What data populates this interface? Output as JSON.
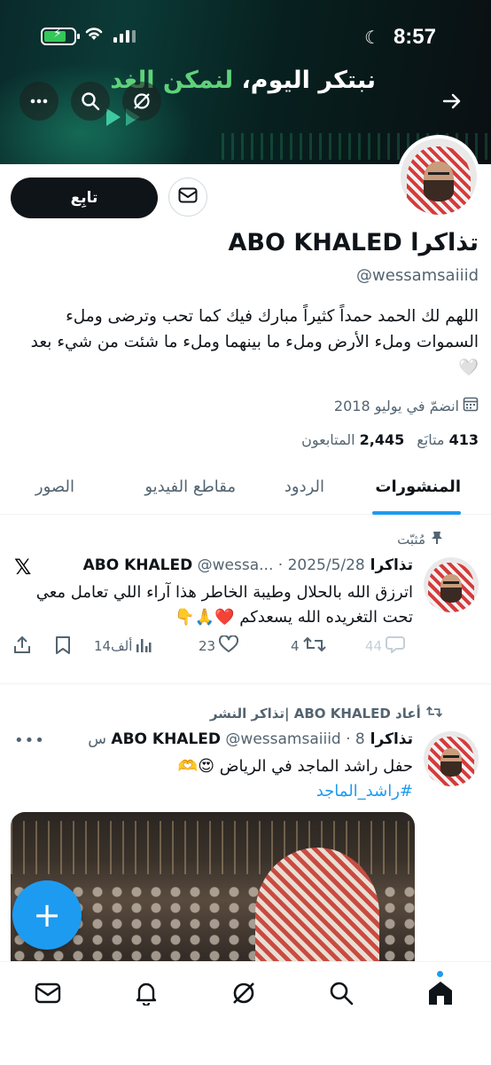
{
  "status_bar": {
    "time": "8:57"
  },
  "banner": {
    "text_white": "نبتكر اليوم، ",
    "text_green": "لنمكن الغد"
  },
  "profile": {
    "follow_label": "تابِع",
    "display_name": "تذاكرا ABO KHALED",
    "handle": "@wessamsaiiid",
    "bio": "اللهم لك الحمد حمداً كثيراً مبارك فيك كما تحب وترضى وملء السموات وملء الأرض وملء ما بينهما وملء ما شئت من شيء بعد",
    "bio_emoji": "🤍",
    "joined": "انضمّ في يوليو 2018",
    "following_count": "413",
    "following_label": "متابَع",
    "followers_count": "2,445",
    "followers_label": "المتابعون"
  },
  "tabs": [
    {
      "label": "المنشورات"
    },
    {
      "label": "الردود"
    },
    {
      "label": "مقاطع الفيديو"
    },
    {
      "label": "الصور"
    }
  ],
  "tweets": [
    {
      "context": "مُثبّت",
      "name": "تذاكرا ABO KHALED",
      "meta": "@wessa... · 2025/5/28",
      "text": "اترزق الله بالحلال وطيبة الخاطر هذا آراء اللي تعامل معي تحت التغريده الله يسعدكم ❤️🙏👇",
      "replies": "44",
      "retweets": "4",
      "likes": "23",
      "views": "14ألف"
    },
    {
      "context": "أعاد ABO KHALED |تذاكر النشر",
      "name": "تذاكرا ABO KHALED",
      "meta": "@wessamsaiiid · 8 س",
      "text": "حفل راشد الماجد في الرياض 😍🫶",
      "hashtag": "#راشد_الماجد"
    }
  ],
  "fab_label": "+",
  "colors": {
    "accent": "#1d9bf0",
    "text": "#0f1419",
    "muted": "#536471",
    "banner_green": "#5fd17a"
  },
  "icons": [
    "back-arrow-icon",
    "grok-icon",
    "search-icon",
    "more-icon",
    "mail-icon",
    "calendar-icon",
    "pin-icon",
    "x-logo-icon",
    "reply-icon",
    "retweet-icon",
    "like-icon",
    "views-icon",
    "bookmark-icon",
    "share-icon",
    "home-icon",
    "notifications-icon",
    "messages-icon"
  ]
}
